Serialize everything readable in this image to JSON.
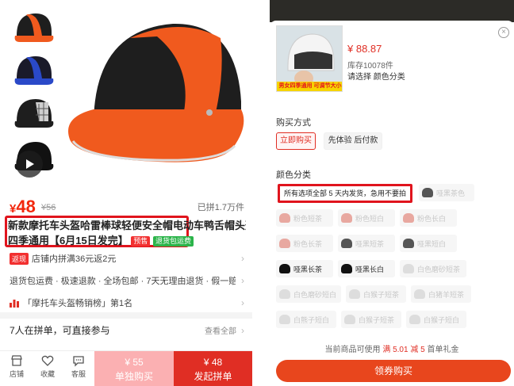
{
  "left": {
    "price": {
      "currency": "¥",
      "value": "48",
      "original": "¥56"
    },
    "sold": "已拼1.7万件",
    "title_line1": "新款摩托车头盔哈雷棒球轻便安全帽电动车鸭舌帽头盔",
    "title_line2": "四季通用【6月15日发完】",
    "tag_presale": "预售",
    "tag_shipping": "退货包运费",
    "cashback_tag": "返现",
    "cashback_text": "店铺内拼满36元返2元",
    "services": "退货包运费 · 极速退款 · 全场包邮 · 7天无理由退货 · 假一赔十",
    "rank": "「摩托车头盔畅销榜」第1名",
    "group_text": "7人在拼单，可直接参与",
    "view_all": "查看全部",
    "bottom": {
      "store": "店铺",
      "favorite": "收藏",
      "service": "客服",
      "single_price": "¥ 55",
      "single_label": "单独购买",
      "group_price": "¥ 48",
      "group_label": "发起拼单"
    }
  },
  "right": {
    "sku_caption": "男女四季通用 可调节大小",
    "price": "¥ 88.87",
    "stock": "库存10078件",
    "select_hint": "请选择 颜色分类",
    "purchase_section": "购买方式",
    "purchase_options": [
      "立即购买",
      "先体验 后付款"
    ],
    "color_section": "颜色分类",
    "notice": "所有选项全部 5 天内发货，急用不要拍",
    "colors": [
      "哑黑茶色",
      "粉色短茶",
      "粉色短白",
      "粉色长白",
      "粉色长茶",
      "哑黑短茶",
      "哑黑短白",
      "哑黑长茶",
      "哑黑长白",
      "白色磨砂短茶",
      "白色磨砂短白",
      "白猴子短茶",
      "白猪羊短茶",
      "白熊子短白",
      "白猴子短茶",
      "白猴子短白"
    ],
    "coupon_prefix": "当前商品可使用",
    "coupon_highlight": "满 5.01 减 5",
    "coupon_suffix": "首单礼金",
    "buy_button": "领券购买"
  },
  "colors": {
    "accent": "#e02e24",
    "frame": "#e0141d",
    "helmet_orange": "#f05a1e",
    "helmet_black": "#1e1e1e"
  }
}
